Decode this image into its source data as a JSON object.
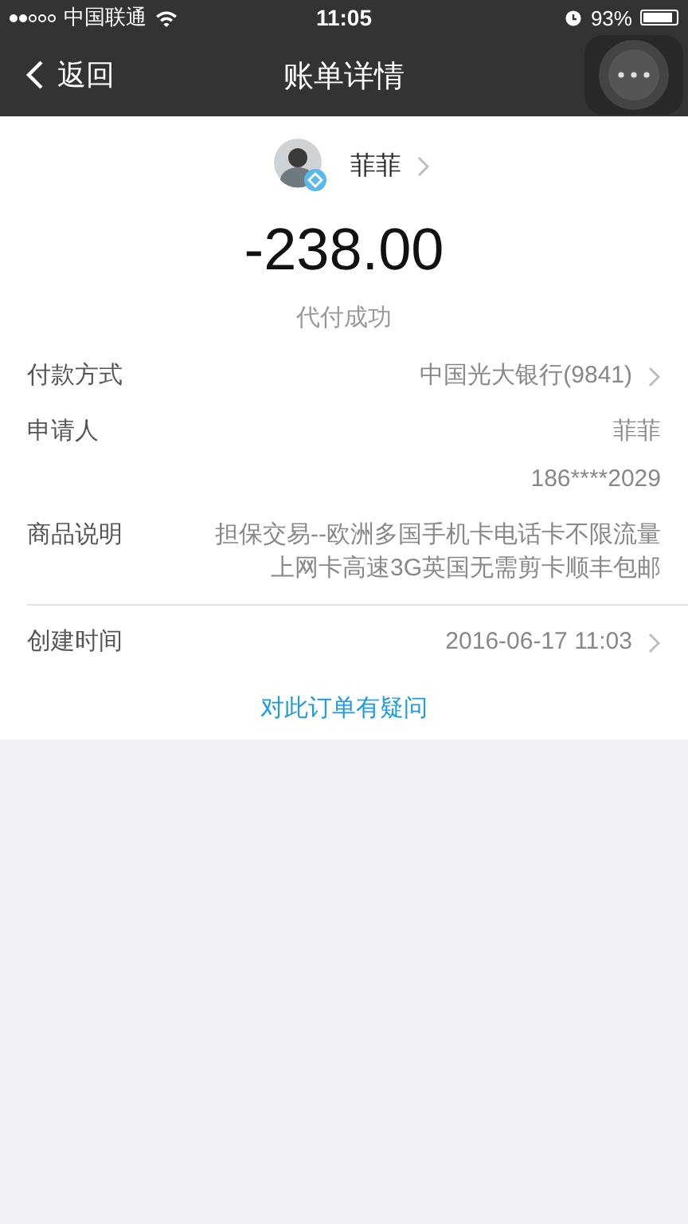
{
  "status_bar": {
    "carrier": "中国联通",
    "time": "11:05",
    "battery": "93%"
  },
  "nav": {
    "back": "返回",
    "title": "账单详情"
  },
  "payee": {
    "name": "菲菲"
  },
  "amount": "-238.00",
  "status": "代付成功",
  "rows": [
    {
      "label": "付款方式",
      "values": [
        "中国光大银行(9841)"
      ],
      "chevron": true,
      "divider": false
    },
    {
      "label": "申请人",
      "values": [
        "菲菲",
        "186****2029"
      ],
      "chevron": false,
      "divider": false
    },
    {
      "label": "商品说明",
      "values": [
        "担保交易--欧洲多国手机卡电话卡不限流量",
        "上网卡高速3G英国无需剪卡顺丰包邮"
      ],
      "chevron": false,
      "divider": true
    },
    {
      "label": "创建时间",
      "values": [
        "2016-06-17 11:03"
      ],
      "chevron": true,
      "divider": false
    }
  ],
  "link": "对此订单有疑问"
}
